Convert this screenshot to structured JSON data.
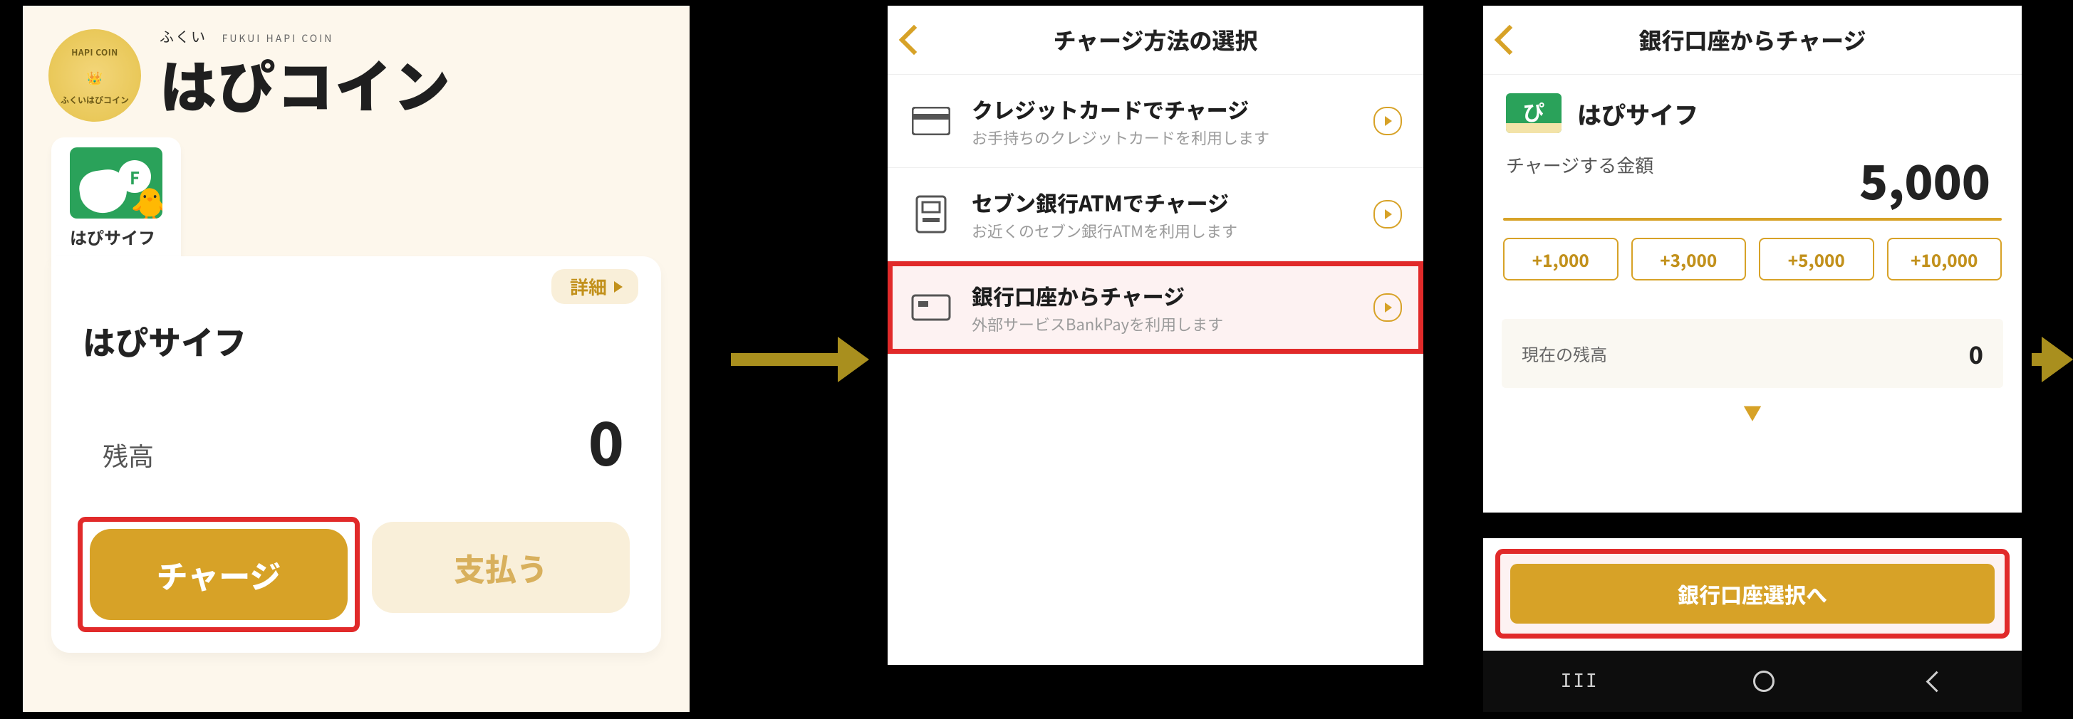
{
  "screen1": {
    "badge": {
      "top": "HAPI COIN",
      "sub": "ふくいはぴコイン"
    },
    "brand": {
      "furigana": "ふくい",
      "tiny": "FUKUI HAPI COIN",
      "main": "はぴコイン"
    },
    "wallet_chip": {
      "name": "はぴサイフ"
    },
    "panel": {
      "detail": "詳細",
      "title": "はぴサイフ",
      "balance_label": "残高",
      "balance_value": "0",
      "charge_btn": "チャージ",
      "pay_btn": "支払う"
    }
  },
  "screen2": {
    "title": "チャージ方法の選択",
    "options": [
      {
        "title": "クレジットカードでチャージ",
        "sub": "お手持ちのクレジットカードを利用します"
      },
      {
        "title": "セブン銀行ATMでチャージ",
        "sub": "お近くのセブン銀行ATMを利用します"
      },
      {
        "title": "銀行口座からチャージ",
        "sub": "外部サービスBankPayを利用します"
      }
    ]
  },
  "screen3": {
    "title": "銀行口座からチャージ",
    "wallet_name": "はぴサイフ",
    "amount_label": "チャージする金額",
    "amount_value": "5,000",
    "presets": [
      "+1,000",
      "+3,000",
      "+5,000",
      "+10,000"
    ],
    "current_balance_label": "現在の残高",
    "current_balance_value": "0",
    "cta": "銀行口座選択へ"
  }
}
